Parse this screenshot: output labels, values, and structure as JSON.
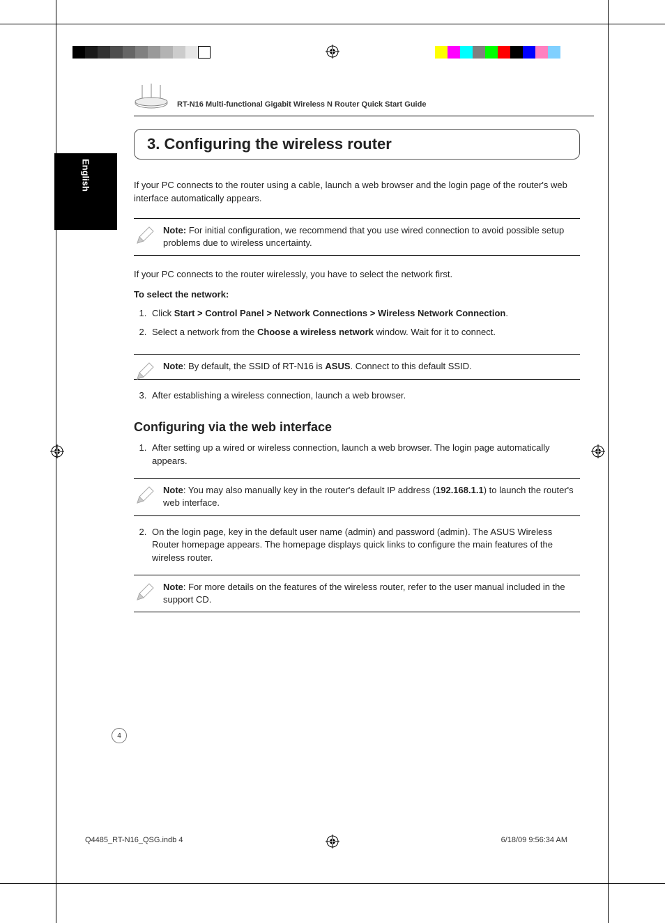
{
  "header": {
    "doc_title": "RT-N16 Multi-functional Gigabit Wireless N Router Quick Start Guide"
  },
  "lang_tab": "English",
  "section": {
    "heading": "3. Configuring the wireless router"
  },
  "intro_p": "If your PC connects to to the router using a cable, launch a web browser and the login page of the router's web interface automatically appears.",
  "note1": {
    "label": "Note:",
    "text": "  For initial configuration, we recommend that you use wired connection to avoid possible setup problems due to wireless uncertainty."
  },
  "wireless_p": "If your PC connects to the router wirelessly, you have to select the network first.",
  "select_heading": "To select the network:",
  "step1_pre": "Click ",
  "step1_bold": "Start > Control Panel > Network Connections > Wireless Network Connection",
  "step1_post": ".",
  "step2_pre": "Select a network from the ",
  "step2_bold": "Choose a wireless network",
  "step2_post": " window. Wait for it to connect.",
  "note2": {
    "label": "Note",
    "pre": ":   By default, the SSID of RT-N16 is ",
    "bold": "ASUS",
    "post": ". Connect to this default SSID."
  },
  "step3": "After establishing a wireless connection, launch a web browser.",
  "subhead": "Configuring via the web interface",
  "web_step1": "After setting up a wired or wireless connection, launch a web browser. The login page automatically appears.",
  "note3": {
    "label": "Note",
    "pre": ": You may also manually key in the router's default IP address (",
    "bold": "192.168.1.1",
    "post": ") to launch the router's web interface."
  },
  "web_step2": "On the login page, key in the default user name (admin) and password (admin). The ASUS Wireless Router homepage appears. The homepage displays quick links to configure the main features of the wireless router.",
  "note4": {
    "label": "Note",
    "text": ": For more details on the features of the wireless router, refer to the user manual included in the support CD."
  },
  "page_number": "4",
  "footer": {
    "file": "Q4485_RT-N16_QSG.indb   4",
    "stamp": "6/18/09   9:56:34 AM"
  },
  "reg_gray": [
    "#000",
    "#1a1a1a",
    "#333",
    "#4d4d4d",
    "#666",
    "#808080",
    "#999",
    "#b3b3b3",
    "#ccc",
    "#e6e6e6",
    "#fff"
  ],
  "reg_color": [
    "#ffff00",
    "#ff00ff",
    "#00ffff",
    "#808080",
    "#00ff00",
    "#ff0000",
    "#000000",
    "#0000ff",
    "#ff80c0",
    "#80d0ff"
  ]
}
